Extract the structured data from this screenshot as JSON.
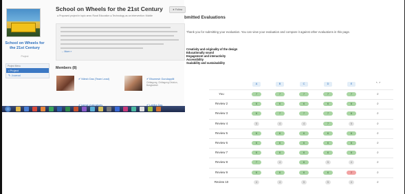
{
  "project": {
    "title": "School on Wheels for the 21st Century",
    "meta": "● Proposed project in topic area: Rural Education   ● Technology as an intervention: Mobile",
    "follow_label": "★ Follow",
    "more_label": "→ More »",
    "sidebar_title": "School on Wheels for the 21st Century",
    "sidebar_sub": "Project",
    "nav_header": "Project Menu",
    "nav_items": [
      "• Project",
      "✎ Journal"
    ],
    "members_heading": "Members (8)",
    "members": [
      {
        "name": "✔ Nilesh Das (Team Lead)",
        "sub": ""
      },
      {
        "name": "✔ Bhumesh Gundappilli",
        "sub": "Chittagong, Chittagong Division, Bangladesh"
      },
      {
        "name": "✔ kamal chakraborty",
        "sub": ""
      },
      {
        "name": "✔ Labiba Das",
        "sub": ""
      }
    ]
  },
  "eval": {
    "title": "bmitted Evaluations",
    "message": "Thank you for submitting your evaluation. You can view your evaluation and compare it against other evaluations in this page.",
    "criteria": [
      "Creativity and originality of the design",
      "Educationally sound",
      "Engagement and interactivity",
      "Accessibility",
      "Scalability and sustainability"
    ],
    "columns": [
      "A",
      "B",
      "C",
      "D",
      "E"
    ],
    "corner_label": "↖ ↗",
    "rows": [
      {
        "label": "You",
        "scores": [
          "7",
          "7",
          "7",
          "7",
          "7"
        ]
      },
      {
        "label": "Review 2",
        "scores": [
          "6",
          "6",
          "6",
          "6",
          "6"
        ]
      },
      {
        "label": "Review 3",
        "scores": [
          "6",
          "7",
          "7",
          "7",
          "6"
        ]
      },
      {
        "label": "Review 4",
        "scores": [
          "5",
          "4",
          "4",
          "7",
          "5"
        ]
      },
      {
        "label": "Review 5",
        "scores": [
          "6",
          "6",
          "6",
          "6",
          "6"
        ]
      },
      {
        "label": "Review 6",
        "scores": [
          "6",
          "6",
          "6",
          "6",
          "6"
        ]
      },
      {
        "label": "Review 7",
        "scores": [
          "6",
          "6",
          "6",
          "6",
          "6"
        ]
      },
      {
        "label": "Review 8",
        "scores": [
          "7",
          "4",
          "6",
          "5",
          "4"
        ]
      },
      {
        "label": "Review 9",
        "scores": [
          "6",
          "6",
          "6",
          "6",
          "2"
        ]
      },
      {
        "label": "Review 10",
        "scores": [
          "4",
          "4",
          "5",
          "5",
          "4"
        ]
      }
    ],
    "score_colors": {
      "high": "#a9d5a3",
      "mid": "#e3e3e3",
      "low": "#f2a3a3"
    }
  }
}
